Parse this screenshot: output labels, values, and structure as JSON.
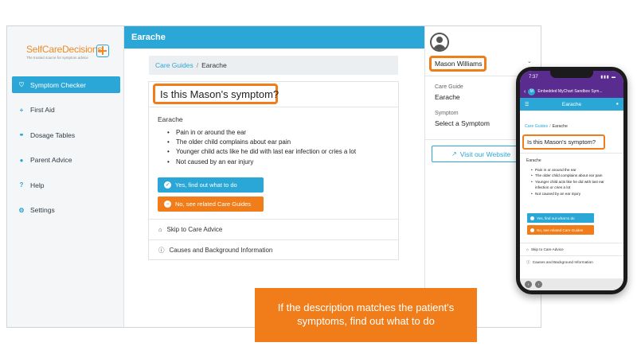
{
  "brand": {
    "name": "SelfCareDecisions",
    "tagline": "The trusted source for symptom advice",
    "accent_color": "#2aa7d6",
    "highlight_color": "#f07d1a"
  },
  "sidebar": {
    "items": [
      {
        "label": "Symptom Checker",
        "icon": "stethoscope-icon",
        "active": true
      },
      {
        "label": "First Aid",
        "icon": "plus-icon",
        "active": false
      },
      {
        "label": "Dosage Tables",
        "icon": "pills-icon",
        "active": false
      },
      {
        "label": "Parent Advice",
        "icon": "chat-bubble-icon",
        "active": false
      },
      {
        "label": "Help",
        "icon": "question-circle-icon",
        "active": false
      },
      {
        "label": "Settings",
        "icon": "gear-icon",
        "active": false
      }
    ]
  },
  "header": {
    "title": "Earache"
  },
  "breadcrumb": {
    "link": "Care Guides",
    "separator": "/",
    "current": "Earache"
  },
  "card": {
    "question": "Is this Mason's symptom?",
    "symptom": "Earache",
    "bullets": [
      "Pain in or around the ear",
      "The older child complains about ear pain",
      "Younger child acts like he did with last ear infection or cries a lot",
      "Not caused by an ear injury"
    ],
    "yes_button": "Yes, find out what to do",
    "no_button": "No, see related Care Guides",
    "skip_link": "Skip to Care Advice",
    "causes_link": "Causes and Background Information"
  },
  "right_panel": {
    "user_name": "Mason Williams",
    "care_guide_label": "Care Guide",
    "care_guide_value": "Earache",
    "symptom_label": "Symptom",
    "symptom_value": "Select a Symptom",
    "visit_button": "Visit our Website"
  },
  "phone": {
    "time": "7:37",
    "app_title": "Embedded MyChart Sandbox Sym...",
    "app_badge": "M",
    "header_title": "Earache",
    "breadcrumb_link": "Care Guides",
    "breadcrumb_separator": "/",
    "breadcrumb_current": "Earache",
    "question": "Is this Mason's symptom?",
    "symptom": "Earache",
    "bullets": [
      "Pain in or around the ear",
      "The older child complains about ear pain",
      "Younger child acts like he did with last ear infection or cries a lot",
      "Not caused by an ear injury"
    ],
    "yes_button": "Yes, find out what to do",
    "no_button": "No, see related Care Guides",
    "skip_link": "Skip to Care Advice",
    "causes_link": "Causes and Background Information"
  },
  "callout": {
    "text": "If the description matches the patient's symptoms, find out what to do"
  }
}
